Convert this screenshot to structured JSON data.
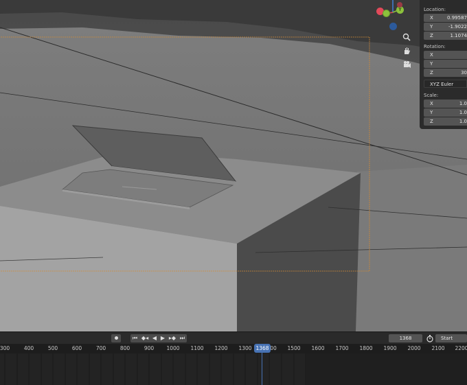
{
  "npanel": {
    "location_label": "Location:",
    "location": [
      {
        "axis": "X",
        "value": "0.99587"
      },
      {
        "axis": "Y",
        "value": "-1.9022"
      },
      {
        "axis": "Z",
        "value": "1.1074"
      }
    ],
    "rotation_label": "Rotation:",
    "rotation": [
      {
        "axis": "X",
        "value": ""
      },
      {
        "axis": "Y",
        "value": ""
      },
      {
        "axis": "Z",
        "value": "30"
      }
    ],
    "rotation_mode": "XYZ Euler",
    "scale_label": "Scale:",
    "scale": [
      {
        "axis": "X",
        "value": "1.0"
      },
      {
        "axis": "Y",
        "value": "1.0"
      },
      {
        "axis": "Z",
        "value": "1.0"
      }
    ]
  },
  "gizmo": {
    "x_color": "#e24a5a",
    "y_color": "#8cc13c",
    "z_color": "#3f7fd9",
    "y_label": "Y"
  },
  "timeline": {
    "current_frame": "1368",
    "start_label": "Start",
    "playback_icons": [
      "record-icon",
      "jump-start-icon",
      "prev-keyframe-icon",
      "play-reverse-icon",
      "play-icon",
      "next-keyframe-icon",
      "jump-end-icon"
    ],
    "ruler": [
      "300",
      "400",
      "500",
      "600",
      "700",
      "800",
      "900",
      "1000",
      "1100",
      "1200",
      "1300",
      "1368",
      "1500",
      "1600",
      "1700",
      "1800",
      "1900",
      "2000",
      "2100",
      "2200"
    ],
    "ruler_partial_after_marker": "00"
  }
}
